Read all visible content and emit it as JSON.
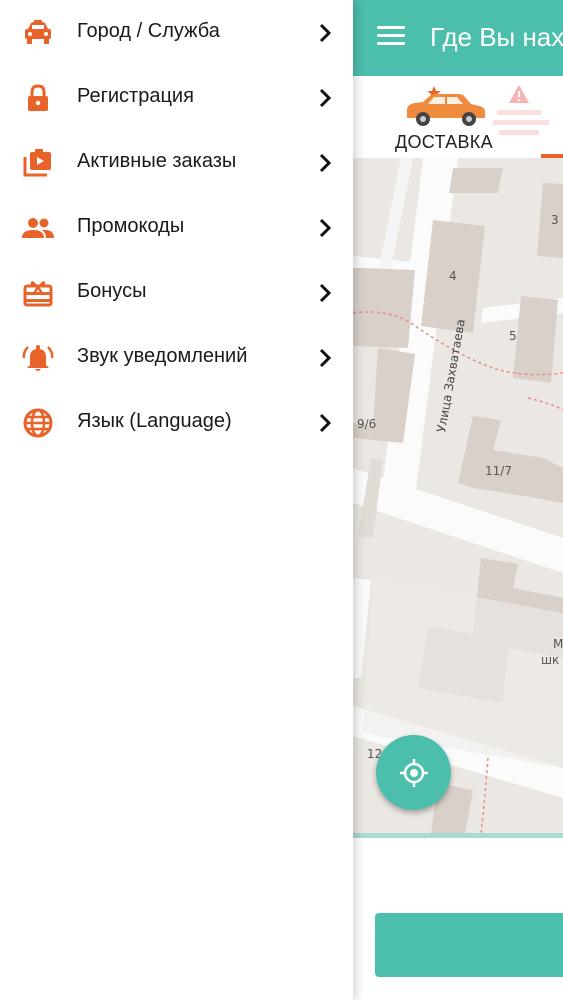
{
  "colors": {
    "accent": "#e8632a",
    "teal": "#4cbeac",
    "text": "#1a1a1a"
  },
  "drawer": {
    "items": [
      {
        "label": "Город / Служба",
        "icon": "taxi-car-icon"
      },
      {
        "label": "Регистрация",
        "icon": "lock-icon"
      },
      {
        "label": "Активные заказы",
        "icon": "video-library-icon"
      },
      {
        "label": "Промокоды",
        "icon": "people-icon"
      },
      {
        "label": "Бонусы",
        "icon": "gift-card-icon"
      },
      {
        "label": "Звук уведомлений",
        "icon": "notification-bell-icon"
      },
      {
        "label": "Язык (Language)",
        "icon": "globe-icon"
      }
    ]
  },
  "app": {
    "title": "Где Вы находитесь?",
    "service": {
      "label": "ДОСТАВКА"
    },
    "map": {
      "street": "Улица Захватаева",
      "labels": [
        "4",
        "5",
        "3",
        "9/6",
        "11/7",
        "12",
        "М",
        "шк"
      ]
    }
  }
}
